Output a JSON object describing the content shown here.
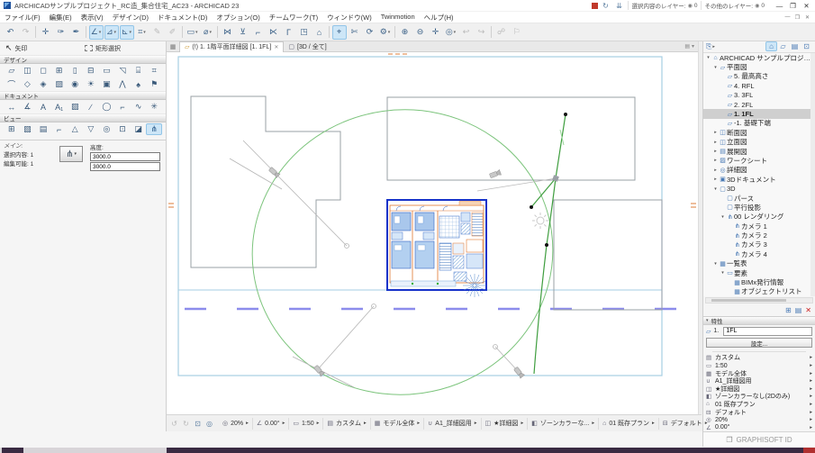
{
  "ui": {
    "arrow_right": "▸",
    "arrow_down": "▾",
    "dd": "▾"
  },
  "window": {
    "title": "ARCHICADサンプルプロジェクト_RC造_集合住宅_AC23 - ARCHICAD 23",
    "minimize": "—",
    "restore": "❐",
    "close": "✕"
  },
  "quickbar": {
    "selected_layers": "選択内容のレイヤー:",
    "other_layers": "その他のレイヤー:",
    "eye": "◉",
    "count_a": "0",
    "count_b": "0",
    "sync1": "↻",
    "sync2": "⇊"
  },
  "menu": {
    "items": [
      {
        "t": "ファイル(F)",
        "n": "menu-file"
      },
      {
        "t": "編集(E)",
        "n": "menu-edit"
      },
      {
        "t": "表示(V)",
        "n": "menu-view"
      },
      {
        "t": "デザイン(D)",
        "n": "menu-design"
      },
      {
        "t": "ドキュメント(D)",
        "n": "menu-document"
      },
      {
        "t": "オプション(O)",
        "n": "menu-options"
      },
      {
        "t": "チームワーク(T)",
        "n": "menu-teamwork"
      },
      {
        "t": "ウィンドウ(W)",
        "n": "menu-window"
      },
      {
        "t": "Twinmotion",
        "n": "menu-twinmotion"
      },
      {
        "t": "ヘルプ(H)",
        "n": "menu-help"
      }
    ]
  },
  "toolbar": {
    "icons": [
      {
        "g": "↶",
        "n": "undo-button"
      },
      {
        "g": "↷",
        "n": "redo-button",
        "cls": "d"
      },
      {
        "g": "",
        "n": "toolbar-separator",
        "cls": "sep",
        "int": "false"
      },
      {
        "g": "✛",
        "n": "user-origin-button"
      },
      {
        "g": "✑",
        "n": "pick-up-parameters-button"
      },
      {
        "g": "✒",
        "n": "inject-parameters-button"
      },
      {
        "g": "",
        "n": "toolbar-separator",
        "cls": "sep",
        "int": "false"
      },
      {
        "g": "∠",
        "n": "snap-guides-toggle",
        "cls": "a dd"
      },
      {
        "g": "⊿",
        "n": "snap-references-toggle",
        "cls": "a dd"
      },
      {
        "g": "⊾",
        "n": "snap-points-toggle",
        "cls": "a dd"
      },
      {
        "g": "⌗",
        "n": "grid-snap-toggle",
        "cls": "dd"
      },
      {
        "g": "✎",
        "n": "guide-line-button",
        "cls": "d"
      },
      {
        "g": "✐",
        "n": "guide-segment-button",
        "cls": "d"
      },
      {
        "g": "",
        "n": "toolbar-separator",
        "cls": "sep",
        "int": "false"
      },
      {
        "g": "▭",
        "n": "marquee-method-button",
        "cls": "dd"
      },
      {
        "g": "⌀",
        "n": "gravity-button",
        "cls": "dd"
      },
      {
        "g": "",
        "n": "toolbar-separator",
        "cls": "sep",
        "int": "false"
      },
      {
        "g": "⋈",
        "n": "trim-button"
      },
      {
        "g": "⊻",
        "n": "split-button"
      },
      {
        "g": "⌐",
        "n": "adjust-button"
      },
      {
        "g": "⋉",
        "n": "intersect-button"
      },
      {
        "g": "Γ",
        "n": "fillet-button"
      },
      {
        "g": "◳",
        "n": "resize-button"
      },
      {
        "g": "⌂",
        "n": "home-story-button"
      },
      {
        "g": "",
        "n": "toolbar-separator",
        "cls": "sep",
        "int": "false"
      },
      {
        "g": "⌖",
        "n": "zoom-to-selection-button",
        "cls": "a"
      },
      {
        "g": "✄",
        "n": "eraser-button"
      },
      {
        "g": "⟳",
        "n": "rebuild-button"
      },
      {
        "g": "⚙",
        "n": "settings-button",
        "cls": "dd"
      },
      {
        "g": "",
        "n": "toolbar-separator",
        "cls": "sep",
        "int": "false"
      },
      {
        "g": "⊕",
        "n": "zoom-in-button"
      },
      {
        "g": "⊖",
        "n": "zoom-out-button"
      },
      {
        "g": "✛",
        "n": "pan-button"
      },
      {
        "g": "◎",
        "n": "zoom-options-button",
        "cls": "dd"
      },
      {
        "g": "↩",
        "n": "previous-view-button",
        "cls": "d"
      },
      {
        "g": "↪",
        "n": "next-view-button",
        "cls": "d"
      },
      {
        "g": "",
        "n": "toolbar-separator",
        "cls": "sep",
        "int": "false"
      },
      {
        "g": "☍",
        "n": "explore-button",
        "cls": "d"
      },
      {
        "g": "⚐",
        "n": "twinmotion-export-button",
        "cls": "d"
      }
    ]
  },
  "toolbox": {
    "arrow_label": "矢印",
    "arrow_icon": "↖",
    "marquee_label": "矩形選択",
    "design_title": "デザイン",
    "document_title": "ドキュメント",
    "view_title": "ビュー",
    "design_row1": [
      {
        "g": "▱",
        "n": "wall-tool"
      },
      {
        "g": "◫",
        "n": "door-tool"
      },
      {
        "g": "◻",
        "n": "window-tool"
      },
      {
        "g": "⊞",
        "n": "curtain-wall-tool"
      },
      {
        "g": "▯",
        "n": "column-tool"
      },
      {
        "g": "⊟",
        "n": "beam-tool"
      },
      {
        "g": "▭",
        "n": "slab-tool"
      },
      {
        "g": "◹",
        "n": "roof-tool"
      },
      {
        "g": "⌸",
        "n": "stair-tool"
      },
      {
        "g": "⌗",
        "n": "railing-tool"
      }
    ],
    "design_row2": [
      {
        "g": "⌒",
        "n": "shell-tool"
      },
      {
        "g": "◇",
        "n": "morph-tool"
      },
      {
        "g": "◈",
        "n": "zone-tool"
      },
      {
        "g": "▨",
        "n": "mesh-tool"
      },
      {
        "g": "◉",
        "n": "opening-tool"
      },
      {
        "g": "☀",
        "n": "lamp-tool"
      },
      {
        "g": "▣",
        "n": "object-tool"
      },
      {
        "g": "⋀",
        "n": "truss-tool"
      },
      {
        "g": "♠",
        "n": "tree-tool"
      },
      {
        "g": "⚑",
        "n": "marker-tool"
      }
    ],
    "document_row": [
      {
        "g": "↔",
        "n": "dimension-tool"
      },
      {
        "g": "∡",
        "n": "angle-dimension-tool"
      },
      {
        "g": "A",
        "n": "text-tool"
      },
      {
        "g": "A₁",
        "n": "label-tool"
      },
      {
        "g": "▨",
        "n": "fill-tool"
      },
      {
        "g": "∕",
        "n": "line-tool"
      },
      {
        "g": "◯",
        "n": "circle-tool"
      },
      {
        "g": "⌐",
        "n": "polyline-tool"
      },
      {
        "g": "∿",
        "n": "spline-tool"
      },
      {
        "g": "✳",
        "n": "hotspot-tool"
      }
    ],
    "view_row": [
      {
        "g": "⊞",
        "n": "zoom-area-tool"
      },
      {
        "g": "▧",
        "n": "figure-tool"
      },
      {
        "g": "▤",
        "n": "drawing-tool"
      },
      {
        "g": "⌐",
        "n": "section-tool"
      },
      {
        "g": "△",
        "n": "elevation-tool"
      },
      {
        "g": "▽",
        "n": "interior-elevation-tool"
      },
      {
        "g": "◎",
        "n": "detail-tool"
      },
      {
        "g": "⊡",
        "n": "worksheet-tool"
      },
      {
        "g": "◪",
        "n": "cutting-plane-tool"
      },
      {
        "g": "⋔",
        "n": "camera-tool",
        "cls": "a"
      }
    ]
  },
  "infobox": {
    "main": "メイン:",
    "selection": "選択内容: 1",
    "editable": "編集可能: 1",
    "camera_icon": "⋔",
    "height_label": "高度:",
    "h1": "3000.0",
    "h2": "3000.0"
  },
  "tabbar": {
    "overview_icon": "▦",
    "tab1": "(!) 1. 1階平面詳細図 [1. 1FL]",
    "tab1_icon": "▱",
    "close": "✕",
    "tab2": "[3D / 全て]",
    "tab2_icon": "▢",
    "options_icon": "▤"
  },
  "navigator": {
    "chooser_icon": "⎘",
    "modes": [
      {
        "g": "⌂",
        "n": "navigator-project-map-button",
        "cls": "a"
      },
      {
        "g": "▱",
        "n": "navigator-view-map-button"
      },
      {
        "g": "▤",
        "n": "navigator-layout-book-button"
      },
      {
        "g": "⊡",
        "n": "navigator-publisher-button"
      }
    ],
    "tree": [
      {
        "ar": "▾",
        "ic": "⌂",
        "t": "ARCHICAD サンプルプロジェクト RC",
        "cls": "d0",
        "n": "tree-root-project"
      },
      {
        "ar": "▾",
        "ic": "▱",
        "t": "平面図",
        "cls": "d1",
        "n": "tree-folder-floor-plans"
      },
      {
        "ar": "",
        "ic": "▱",
        "t": "5. 最高高さ",
        "cls": "d2",
        "n": "tree-story-5"
      },
      {
        "ar": "",
        "ic": "▱",
        "t": "4. RFL",
        "cls": "d2",
        "n": "tree-story-4"
      },
      {
        "ar": "",
        "ic": "▱",
        "t": "3. 3FL",
        "cls": "d2",
        "n": "tree-story-3"
      },
      {
        "ar": "",
        "ic": "▱",
        "t": "2. 2FL",
        "cls": "d2",
        "n": "tree-story-2"
      },
      {
        "ar": "",
        "ic": "▱",
        "t": "1. 1FL",
        "cls": "d2 sel",
        "n": "tree-story-1-selected"
      },
      {
        "ar": "",
        "ic": "▱",
        "t": "-1. 基礎下端",
        "cls": "d2",
        "n": "tree-story-minus1"
      },
      {
        "ar": "▸",
        "ic": "◫",
        "t": "断面図",
        "cls": "d1",
        "n": "tree-folder-sections"
      },
      {
        "ar": "▸",
        "ic": "◫",
        "t": "立面図",
        "cls": "d1",
        "n": "tree-folder-elevations"
      },
      {
        "ar": "▸",
        "ic": "▤",
        "t": "展開図",
        "cls": "d1",
        "n": "tree-folder-interior-elevations"
      },
      {
        "ar": "▸",
        "ic": "▨",
        "t": "ワークシート",
        "cls": "d1",
        "n": "tree-folder-worksheets"
      },
      {
        "ar": "▸",
        "ic": "◎",
        "t": "詳細図",
        "cls": "d1",
        "n": "tree-folder-details"
      },
      {
        "ar": "▸",
        "ic": "▣",
        "t": "3Dドキュメント",
        "cls": "d1",
        "n": "tree-folder-3d-documents"
      },
      {
        "ar": "▾",
        "ic": "▢",
        "t": "3D",
        "cls": "d1",
        "n": "tree-folder-3d"
      },
      {
        "ar": "",
        "ic": "▢",
        "t": "パース",
        "cls": "d2",
        "n": "tree-item-perspective"
      },
      {
        "ar": "",
        "ic": "▢",
        "t": "平行投影",
        "cls": "d2",
        "n": "tree-item-axonometry"
      },
      {
        "ar": "▾",
        "ic": "⋔",
        "t": "00 レンダリング",
        "cls": "d2",
        "n": "tree-folder-rendering"
      },
      {
        "ar": "",
        "ic": "⋔",
        "t": "カメラ 1",
        "cls": "d3",
        "n": "tree-item-camera-1"
      },
      {
        "ar": "",
        "ic": "⋔",
        "t": "カメラ 2",
        "cls": "d3",
        "n": "tree-item-camera-2"
      },
      {
        "ar": "",
        "ic": "⋔",
        "t": "カメラ 3",
        "cls": "d3",
        "n": "tree-item-camera-3"
      },
      {
        "ar": "",
        "ic": "⋔",
        "t": "カメラ 4",
        "cls": "d3",
        "n": "tree-item-camera-4"
      },
      {
        "ar": "▾",
        "ic": "▦",
        "t": "一覧表",
        "cls": "d1",
        "n": "tree-folder-schedules"
      },
      {
        "ar": "▾",
        "ic": "▭",
        "t": "要素",
        "cls": "d2",
        "n": "tree-folder-elements"
      },
      {
        "ar": "",
        "ic": "▦",
        "t": "BIMx発行情報",
        "cls": "d3",
        "n": "tree-item-bimx-publish"
      },
      {
        "ar": "",
        "ic": "▦",
        "t": "オブジェクトリスト",
        "cls": "d3",
        "n": "tree-item-object-list"
      }
    ],
    "actions": [
      {
        "g": "⊞",
        "n": "navigator-clone-button"
      },
      {
        "g": "▤",
        "n": "navigator-new-folder-button"
      },
      {
        "g": "✕",
        "n": "navigator-delete-button",
        "cls": "red"
      }
    ],
    "properties_title": "特性",
    "item_icon": "▱",
    "item_no": "1.",
    "item_name": "1FL",
    "settings": "設定...",
    "props": [
      {
        "ic": "▤",
        "t": "カスタム",
        "n": "prop-layer-combination"
      },
      {
        "ic": "▭",
        "t": "1:50",
        "n": "prop-scale"
      },
      {
        "ic": "▦",
        "t": "モデル全体",
        "n": "prop-structure-display"
      },
      {
        "ic": "∪",
        "t": "A1_詳細図用",
        "n": "prop-pen-set"
      },
      {
        "ic": "◫",
        "t": "★詳細図",
        "n": "prop-model-view-options"
      },
      {
        "ic": "◧",
        "t": "ゾーンカラーなし(2Dのみ)",
        "n": "prop-graphic-override"
      },
      {
        "ic": "⌂",
        "t": "01 既存プラン",
        "n": "prop-renovation-filter"
      },
      {
        "ic": "⊟",
        "t": "デフォルト",
        "n": "prop-dimension-style"
      },
      {
        "ic": "◎",
        "t": "20%",
        "n": "prop-zoom"
      },
      {
        "ic": "∠",
        "t": "0.00°",
        "n": "prop-orientation"
      }
    ],
    "graphisoft": "GRAPHISOFT ID",
    "graphisoft_icon": "❐"
  },
  "statusbar": {
    "nav_icons": [
      {
        "g": "↺",
        "n": "zoom-back-button",
        "cls": "d"
      },
      {
        "g": "↻",
        "n": "zoom-forward-button",
        "cls": "d"
      },
      {
        "g": "⊡",
        "n": "fit-in-window-button"
      },
      {
        "g": "◎",
        "n": "zoom-tool-button"
      }
    ],
    "items": [
      {
        "ic": "◎",
        "t": "20%",
        "n": "quick-zoom"
      },
      {
        "ic": "∠",
        "t": "0.00°",
        "n": "quick-orientation"
      },
      {
        "ic": "▭",
        "t": "1:50",
        "n": "quick-scale"
      },
      {
        "ic": "▤",
        "t": "カスタム",
        "n": "quick-layer-combination"
      },
      {
        "ic": "▦",
        "t": "モデル全体",
        "n": "quick-structure-display"
      },
      {
        "ic": "∪",
        "t": "A1_詳細図用",
        "n": "quick-pen-set"
      },
      {
        "ic": "◫",
        "t": "★詳細図",
        "n": "quick-model-view-options"
      },
      {
        "ic": "◧",
        "t": "ゾーンカラーな...",
        "n": "quick-graphic-override"
      },
      {
        "ic": "⌂",
        "t": "01 既存プラン",
        "n": "quick-renovation-filter"
      },
      {
        "ic": "⊟",
        "t": "デフォルト",
        "n": "quick-dimension-style"
      }
    ]
  }
}
